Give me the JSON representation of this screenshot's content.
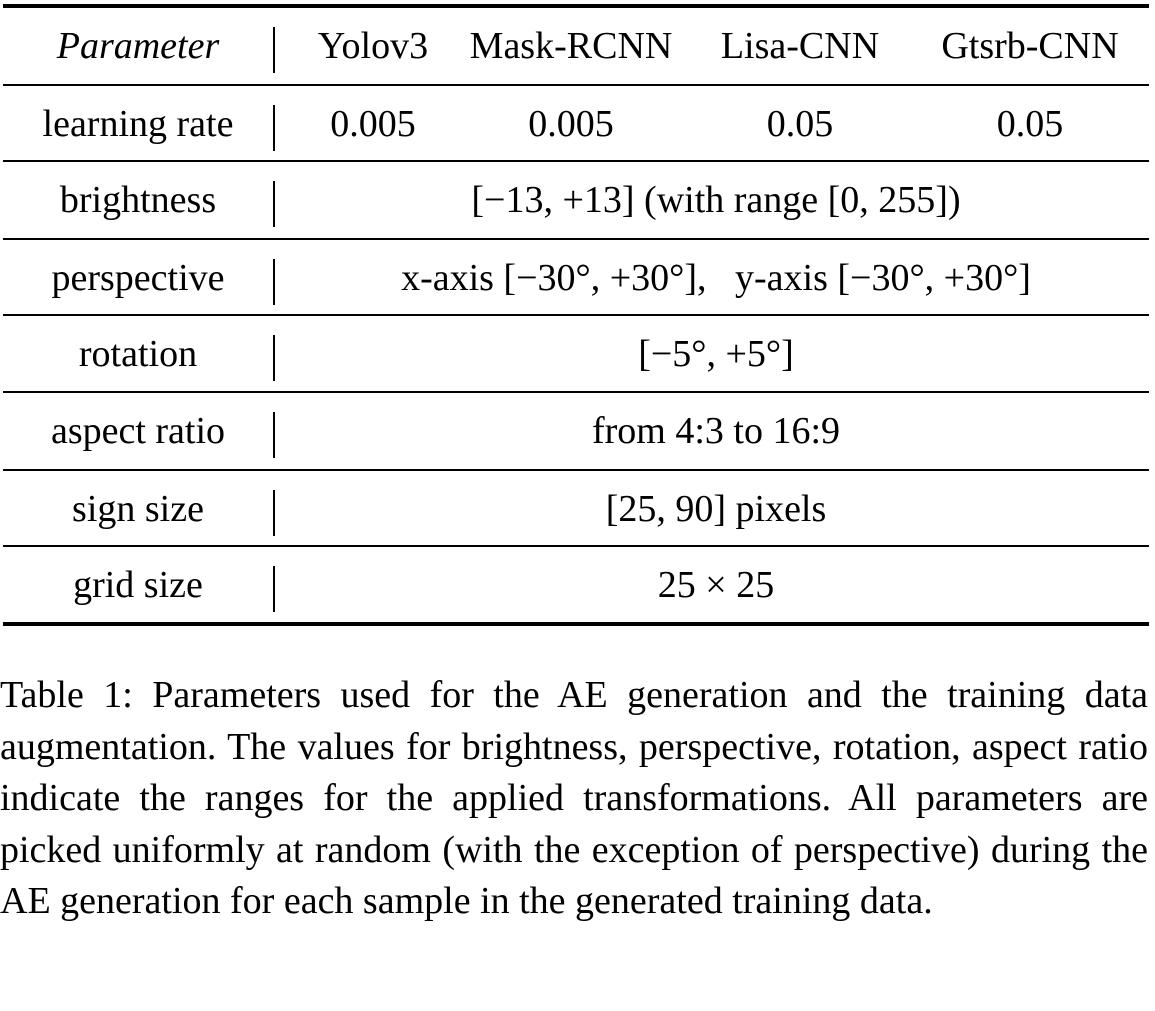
{
  "table": {
    "header": {
      "parameter": "Parameter",
      "models": [
        "Yolov3",
        "Mask-RCNN",
        "Lisa-CNN",
        "Gtsrb-CNN"
      ]
    },
    "rows": [
      {
        "name": "learning rate",
        "values": [
          "0.005",
          "0.005",
          "0.05",
          "0.05"
        ]
      },
      {
        "name": "brightness",
        "value": "[−13, +13] (with range [0, 255])"
      },
      {
        "name": "perspective",
        "value": "x-axis [−30°, +30°],   y-axis [−30°, +30°]"
      },
      {
        "name": "rotation",
        "value": "[−5°, +5°]"
      },
      {
        "name": "aspect ratio",
        "value": "from 4:3 to 16:9"
      },
      {
        "name": "sign size",
        "value": "[25, 90] pixels"
      },
      {
        "name": "grid size",
        "value": "25 × 25"
      }
    ]
  },
  "caption": "Table 1: Parameters used for the AE generation and the training data augmentation. The values for brightness, perspective, rotation, aspect ratio indicate the ranges for the applied transformations. All parameters are picked uniformly at random (with the exception of perspective) during the AE generation for each sample in the generated training data."
}
